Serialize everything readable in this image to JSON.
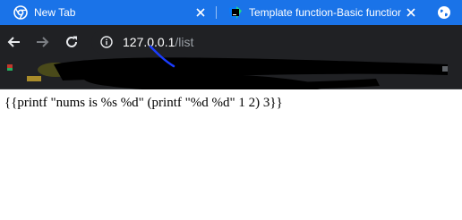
{
  "browser": {
    "tabs": [
      {
        "title": "New Tab",
        "icon": "chrome-icon",
        "active": false
      },
      {
        "title": "Template function-Basic functions",
        "icon": "goland-icon",
        "active": false
      }
    ],
    "address_bar": {
      "host": "127.0.0.1",
      "path": "/list"
    }
  },
  "page": {
    "body_text": "{{printf \"nums is %s %d\" (printf \"%d %d\" 1 2) 3}}"
  },
  "colors": {
    "tabstrip": "#1a73e8",
    "toolbar": "#202124",
    "url_host": "#ffffff",
    "url_path": "#9aa0a6",
    "page_bg": "#ffffff",
    "redaction": "#000000"
  }
}
